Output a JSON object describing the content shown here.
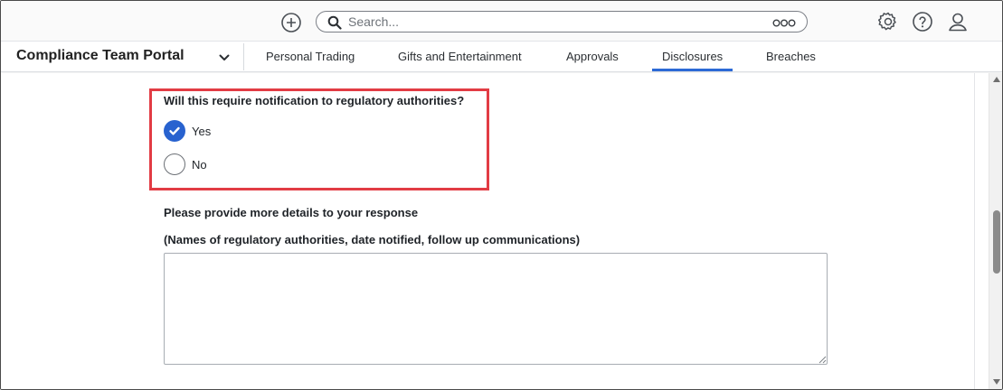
{
  "topbar": {
    "search_placeholder": "Search...",
    "icons": [
      "add-icon",
      "search-icon",
      "more-icon",
      "gear-icon",
      "help-icon",
      "user-icon"
    ]
  },
  "nav": {
    "portal_title": "Compliance Team Portal",
    "tabs": [
      {
        "label": "Personal Trading",
        "active": false
      },
      {
        "label": "Gifts and Entertainment",
        "active": false
      },
      {
        "label": "Approvals",
        "active": false
      },
      {
        "label": "Disclosures",
        "active": true
      },
      {
        "label": "Breaches",
        "active": false
      }
    ],
    "active_color": "#2c6ad6"
  },
  "form": {
    "question": "Will this require notification to regulatory authorities?",
    "options": [
      {
        "label": "Yes",
        "selected": true
      },
      {
        "label": "No",
        "selected": false
      }
    ],
    "details_label": "Please provide more details to your response",
    "details_hint": "(Names of regulatory authorities, date notified, follow up communications)",
    "details_value": "",
    "highlight_color": "#e23c44",
    "radio_color": "#2862cf"
  }
}
